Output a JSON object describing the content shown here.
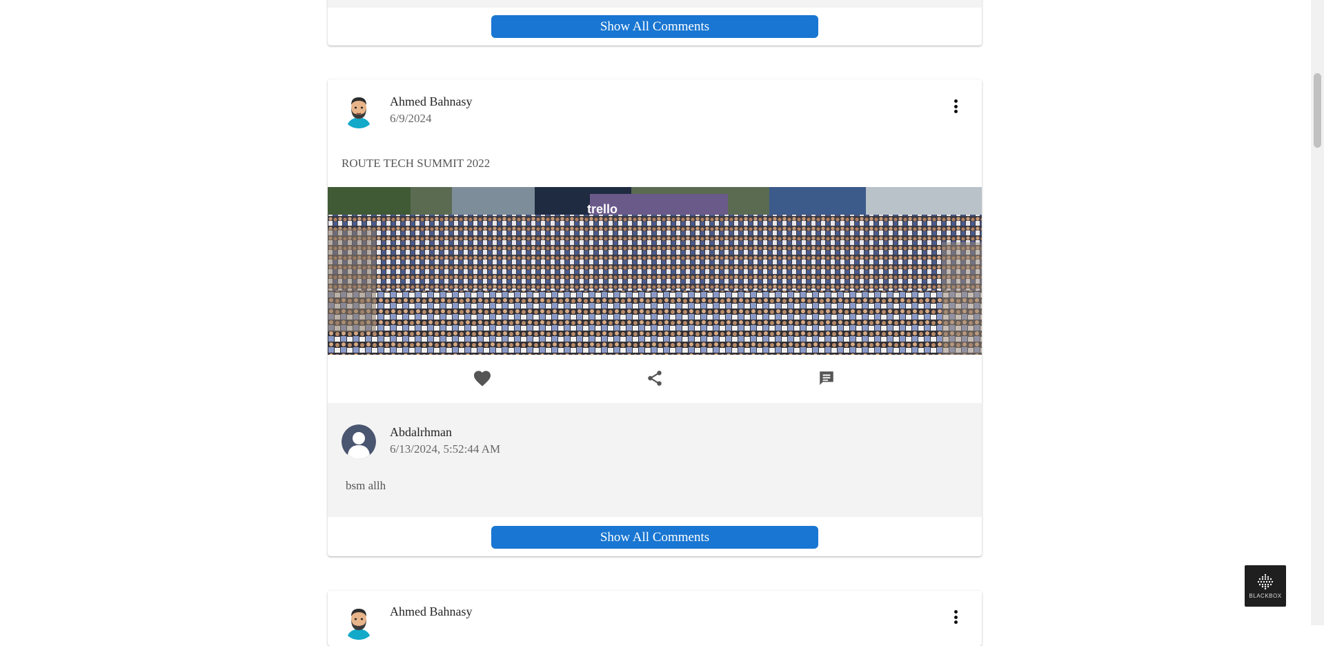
{
  "post1": {
    "show_comments_label": "Show All Comments"
  },
  "post2": {
    "author": "Ahmed Bahnasy",
    "date": "6/9/2024",
    "text": "ROUTE TECH SUMMIT 2022",
    "photo_caption": "trello",
    "comment": {
      "author": "Abdalrhman",
      "date": "6/13/2024, 5:52:44 AM",
      "text": "bsm allh"
    },
    "show_comments_label": "Show All Comments"
  },
  "post3": {
    "author": "Ahmed Bahnasy"
  },
  "badge": {
    "label": "BLACKBOX"
  },
  "colors": {
    "accent": "#1976d2",
    "comment_bg": "#f3f3f3"
  },
  "icons": [
    "dots-vertical-icon",
    "heart-icon",
    "share-icon",
    "comment-icon",
    "default-user-avatar"
  ]
}
